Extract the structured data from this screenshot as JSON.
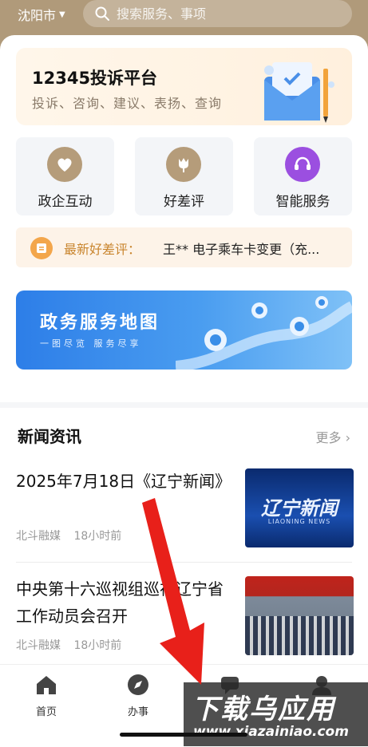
{
  "header": {
    "city": "沈阳市",
    "search_placeholder": "搜索服务、事项"
  },
  "complaint_card": {
    "title": "12345投诉平台",
    "subtitle": "投诉、咨询、建议、表扬、查询"
  },
  "tiles": [
    {
      "label": "政企互动",
      "icon": "handshake-heart-icon"
    },
    {
      "label": "好差评",
      "icon": "tulip-icon"
    },
    {
      "label": "智能服务",
      "icon": "headset-icon"
    }
  ],
  "review_bar": {
    "label": "最新好差评：",
    "text": "王**    电子乘车卡变更（充..."
  },
  "map_banner": {
    "title": "政务服务地图",
    "subtitle": "一图尽览  服务尽享"
  },
  "news": {
    "heading": "新闻资讯",
    "more": "更多",
    "items": [
      {
        "title": "2025年7月18日《辽宁新闻》",
        "source": "北斗融媒",
        "time": "18小时前",
        "thumb_text": "辽宁新闻",
        "thumb_sub": "LIAONING NEWS"
      },
      {
        "title": "中央第十六巡视组巡视辽宁省工作动员会召开",
        "source": "北斗融媒",
        "time": "18小时前"
      }
    ]
  },
  "tabbar": [
    {
      "label": "首页",
      "icon": "home-icon"
    },
    {
      "label": "办事",
      "icon": "compass-icon"
    },
    {
      "label": "",
      "icon": "chat-icon"
    },
    {
      "label": "",
      "icon": "user-icon"
    }
  ],
  "watermark": {
    "line1": "下载乌应用",
    "line2": "www.xiazainiao.com"
  },
  "colors": {
    "header_bg": "#b09a7a",
    "accent_orange": "#c9852e",
    "map_blue": "#2d7ee8",
    "arrow_red": "#e8201a"
  }
}
